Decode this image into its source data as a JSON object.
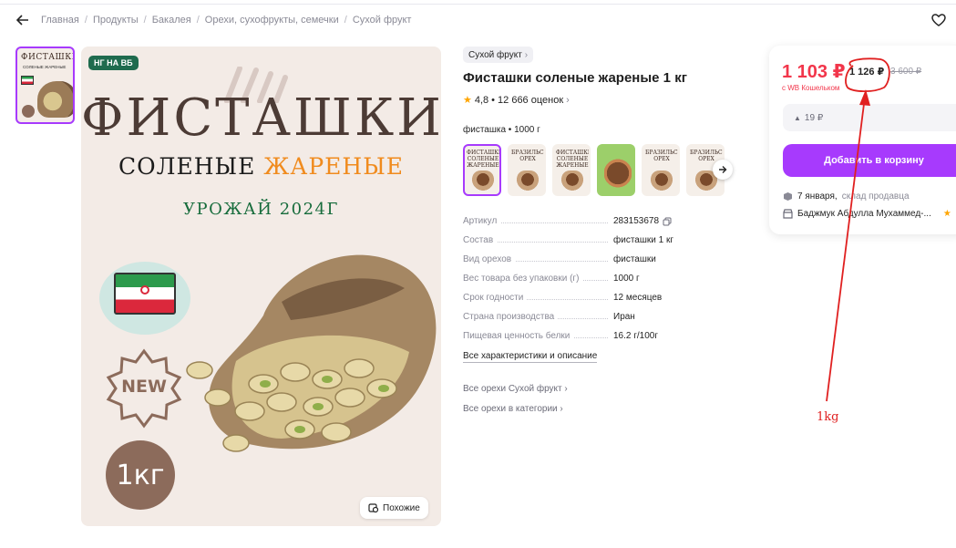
{
  "breadcrumbs": [
    "Главная",
    "Продукты",
    "Бакалея",
    "Орехи, сухофрукты, семечки",
    "Сухой фрукт"
  ],
  "gallery": {
    "badge": "НГ НА ВБ",
    "title": "ФИСТАШКИ",
    "subtitle_1": "СОЛЕНЫЕ",
    "subtitle_2": "ЖАРЕНЫЕ",
    "harvest": "УРОЖАЙ 2024Г",
    "new_label": "NEW",
    "weight_label": "1кг",
    "similar_button": "Похожие",
    "thumb_title": "ФИСТАШКИ",
    "thumb_subtitle": "СОЛЕНЫЕ ЖАРЕНЫЕ"
  },
  "product": {
    "category_chip": "Сухой фрукт",
    "title": "Фисташки соленые жареные 1 кг",
    "rating": "4,8",
    "reviews": "12 666 оценок",
    "variant_label": "фисташка • 1000 г",
    "variants": [
      {
        "title": "ФИСТАШКИ СОЛЕНЫЕ ЖАРЕНЫЕ",
        "style": "active"
      },
      {
        "title": "БРАЗИЛЬСКИЙ ОРЕХ",
        "style": ""
      },
      {
        "title": "ФИСТАШКИ СОЛЕНЫЕ ЖАРЕНЫЕ",
        "style": ""
      },
      {
        "title": "",
        "style": "green"
      },
      {
        "title": "БРАЗИЛЬСКИЙ ОРЕХ",
        "style": ""
      },
      {
        "title": "БРАЗИЛЬСКИЙ ОРЕХ",
        "style": ""
      }
    ],
    "specs": [
      {
        "key": "Артикул",
        "value": "283153678",
        "copy": true
      },
      {
        "key": "Состав",
        "value": "фисташки 1 кг"
      },
      {
        "key": "Вид орехов",
        "value": "фисташки"
      },
      {
        "key": "Вес товара без упаковки (г)",
        "value": "1000 г"
      },
      {
        "key": "Срок годности",
        "value": "12 месяцев"
      },
      {
        "key": "Страна производства",
        "value": "Иран"
      },
      {
        "key": "Пищевая ценность белки",
        "value": "16.2 г/100г"
      }
    ],
    "all_specs_link": "Все характеристики и описание",
    "link_all_category": "Все орехи Сухой фрукт",
    "link_all_in_category": "Все орехи в категории"
  },
  "buy": {
    "price": "1 103 ₽",
    "price_no_wallet": "1 126 ₽",
    "old_price": "3 600 ₽",
    "wallet_note": "с WB Кошельком",
    "price_history": "19 ₽",
    "add_to_cart": "Добавить в корзину",
    "delivery_date": "7 января,",
    "delivery_source": "склад продавца",
    "seller": "Баджмук Абдулла Мухаммед-..."
  },
  "annotation": {
    "text": "1kg",
    "color": "#e02020"
  },
  "colors": {
    "accent": "#a73afd",
    "price": "#f2364b",
    "star": "#ffa500"
  }
}
